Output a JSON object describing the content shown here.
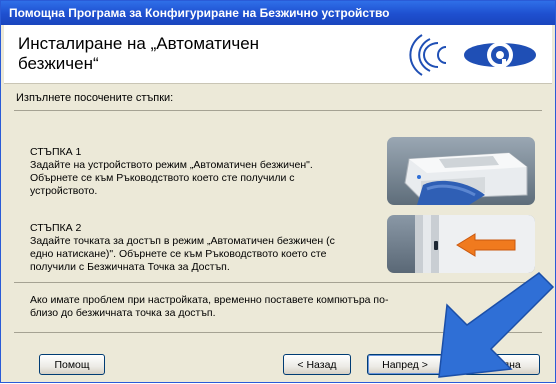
{
  "window": {
    "title": "Помощна Програма за Конфигуриране на Безжично устройство"
  },
  "header": {
    "title": "Инсталиране на „Автоматичен безжичен“"
  },
  "content": {
    "instruction": "Изпълнете посочените стъпки:",
    "steps": [
      {
        "title": "СТЪПКА 1",
        "text": "Задайте на устройството режим „Автоматичен безжичен\". Обърнете се към Ръководството което сте получили с устройството."
      },
      {
        "title": "СТЪПКА 2",
        "text": "Задайте точката за достъп в режим „Автоматичен безжичен (с едно натискане)\". Обърнете се към Ръководството което сте получили с Безжичната Точка за Достъп."
      }
    ],
    "note": "Ако имате проблем при настройката, временно поставете компютъра по-близо до безжичната точка за достъп."
  },
  "buttons": {
    "help": "Помощ",
    "back": "< Назад",
    "next": "Напред >",
    "cancel": "Отмяна"
  },
  "colors": {
    "title_bar": "#2563e0",
    "dialog_bg": "#ece9d8",
    "logo_blue": "#1f4fb5",
    "arrow_blue": "#2f6fd6",
    "arrow_orange": "#f07a1e"
  }
}
